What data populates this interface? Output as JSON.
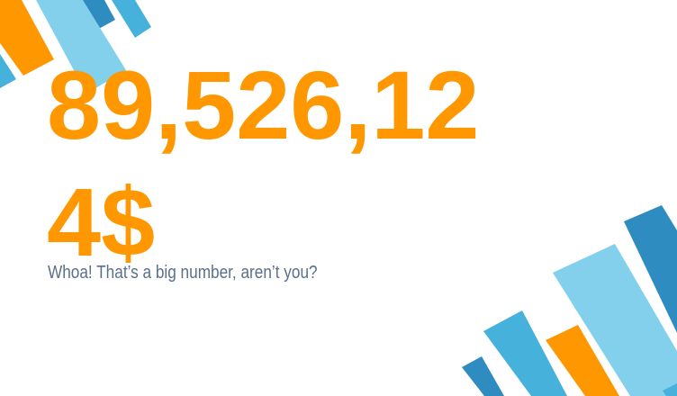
{
  "slide": {
    "big_number": "89,526,124$",
    "subtitle": "Whoa! That’s a big number, aren’t you?"
  },
  "colors": {
    "accent_orange": "#ff9800",
    "subtitle_text": "#5a6f8a",
    "bar_light_blue": "#82d0ec",
    "bar_mid_blue": "#46b1da",
    "bar_dark_blue": "#2f8cc0",
    "background": "#ffffff"
  },
  "decorations": {
    "top_left": "diagonal-stripes",
    "bottom_right": "diagonal-stripes"
  }
}
